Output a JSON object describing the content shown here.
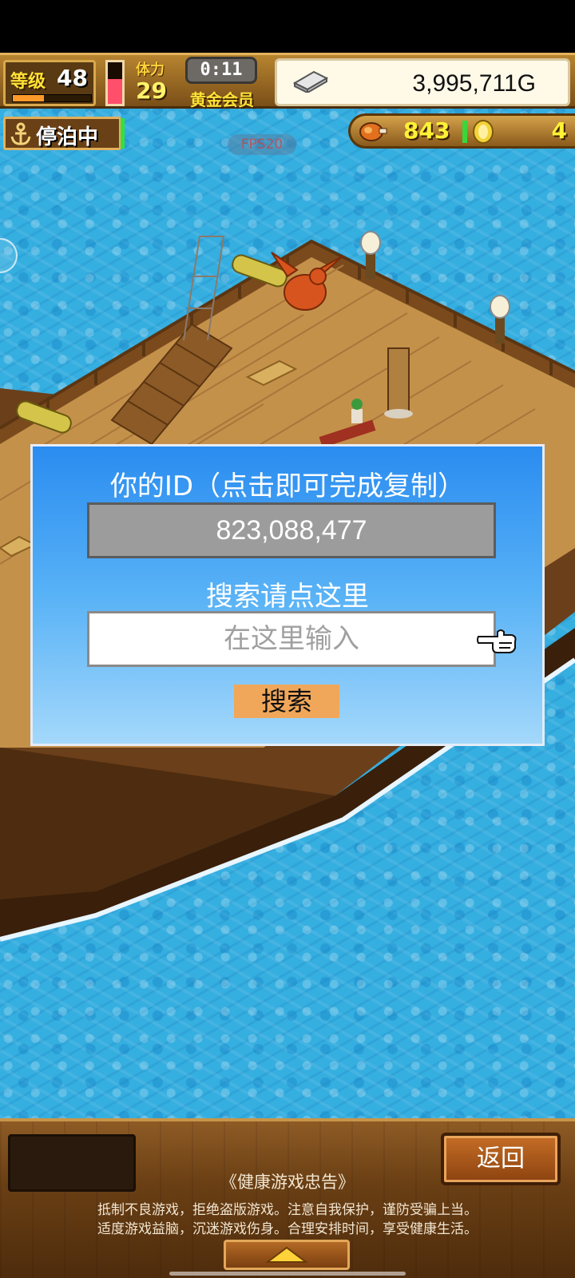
{
  "hud": {
    "level_label": "等级",
    "level_value": "48",
    "level_progress": 0.4,
    "stamina_label": "体力",
    "stamina_value": "29",
    "stamina_level": 0.6,
    "timer": "0:11",
    "membership": "黄金会员",
    "money": "3,995,711G",
    "status": "停泊中",
    "fps": "FPS20",
    "food": "843",
    "coins": "4"
  },
  "dialog": {
    "title": "你的ID（点击即可完成复制）",
    "player_id": "823,088,477",
    "search_hint": "搜索请点这里",
    "search_placeholder": "在这里输入",
    "search_button": "搜索"
  },
  "bottom": {
    "back_button": "返回",
    "health_title": "《健康游戏忠告》",
    "health_line1": "抵制不良游戏，拒绝盗版游戏。注意自我保护，谨防受骗上当。",
    "health_line2": "适度游戏益脑，沉迷游戏伤身。合理安排时间，享受健康生活。"
  },
  "colors": {
    "sea": "#35aee0",
    "dialog_top": "#2a8cf0",
    "search_button": "#f0a75a",
    "wood": "#8e5b25"
  },
  "icons": [
    "anchor-icon",
    "silver-bar-icon",
    "food-icon",
    "coin-icon",
    "pointing-hand-icon",
    "up-arrow-icon"
  ]
}
